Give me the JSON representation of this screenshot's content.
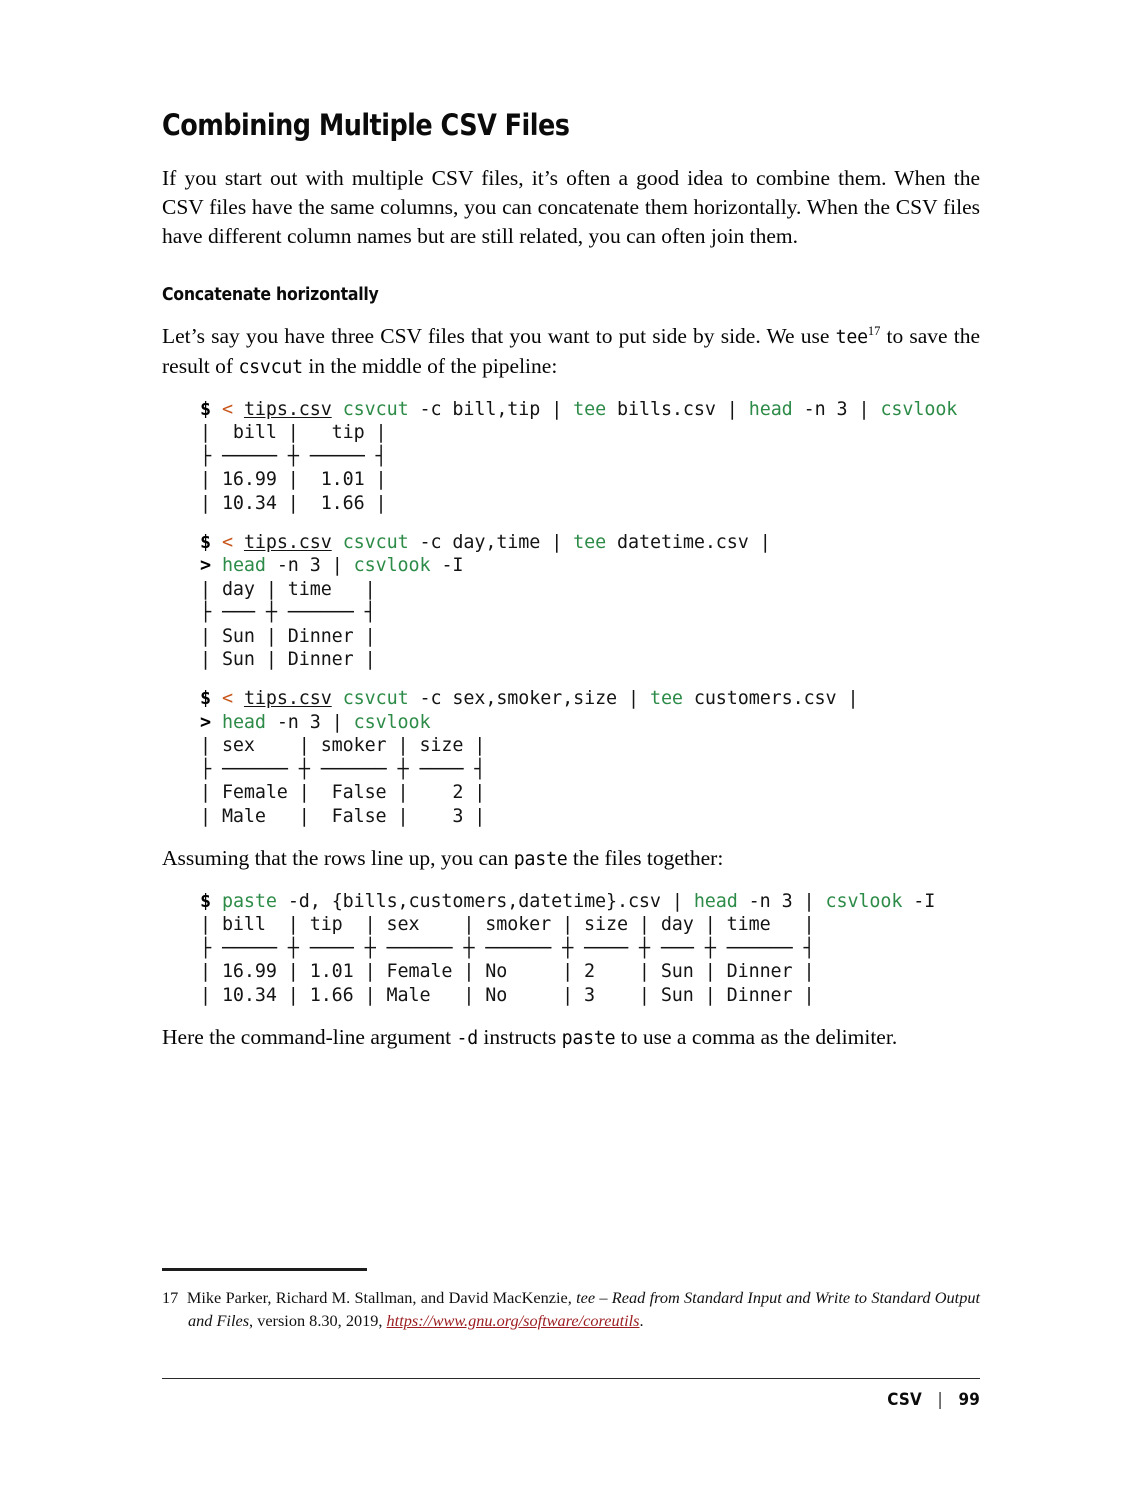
{
  "page": {
    "chapter_title": "Combining Multiple CSV Files",
    "footer_label": "CSV",
    "footer_separator": "|",
    "footer_page_number": "99"
  },
  "intro": {
    "paragraph": "If you start out with multiple CSV files, it’s often a good idea to combine them. When the CSV files have the same columns, you can concatenate them horizontally. When the CSV files have different column names but are still related, you can often join them."
  },
  "section": {
    "title": "Concatenate horizontally",
    "lead_part1": "Let’s say you have three CSV files that you want to put side by side. We use ",
    "lead_code1": "tee",
    "lead_footnote_marker": "17",
    "lead_part2": " to save the result of ",
    "lead_code2": "csvcut",
    "lead_part3": " in the middle of the pipeline:"
  },
  "assume": {
    "part1": "Assuming that the rows line up, you can ",
    "code": "paste",
    "part2": " the files together:"
  },
  "closing": {
    "part1": "Here the command-line argument ",
    "code1": "-d",
    "part2": " instructs ",
    "code2": "paste",
    "part3": " to use a comma as the delimiter."
  },
  "colors": {
    "command_green": "#2d8b48",
    "redirect_orange": "#c8551a",
    "url_red": "#9b1b1f",
    "text_black": "#111111"
  },
  "code_blocks": [
    {
      "id": "bills",
      "lines": [
        {
          "tokens": [
            {
              "t": "$",
              "c": "prompt"
            },
            {
              "t": " ",
              "c": "plain"
            },
            {
              "t": "<",
              "c": "redir"
            },
            {
              "t": " ",
              "c": "plain"
            },
            {
              "t": "tips.csv",
              "c": "file"
            },
            {
              "t": " ",
              "c": "plain"
            },
            {
              "t": "csvcut",
              "c": "cmd"
            },
            {
              "t": " -c bill,tip ",
              "c": "plain"
            },
            {
              "t": "|",
              "c": "pipe"
            },
            {
              "t": " ",
              "c": "plain"
            },
            {
              "t": "tee",
              "c": "cmd"
            },
            {
              "t": " bills.csv ",
              "c": "plain"
            },
            {
              "t": "|",
              "c": "pipe"
            },
            {
              "t": " ",
              "c": "plain"
            },
            {
              "t": "head",
              "c": "cmd"
            },
            {
              "t": " -n 3 ",
              "c": "plain"
            },
            {
              "t": "|",
              "c": "pipe"
            },
            {
              "t": " ",
              "c": "plain"
            },
            {
              "t": "csvlook",
              "c": "cmd"
            }
          ]
        },
        {
          "tokens": [
            {
              "t": "|  bill |   tip |",
              "c": "plain"
            }
          ]
        },
        {
          "tokens": [
            {
              "t": "| ----- + ----- |",
              "c": "plain"
            }
          ]
        },
        {
          "tokens": [
            {
              "t": "| 16.99 |  1.01 |",
              "c": "plain"
            }
          ]
        },
        {
          "tokens": [
            {
              "t": "| 10.34 |  1.66 |",
              "c": "plain"
            }
          ]
        }
      ]
    },
    {
      "id": "datetime",
      "lines": [
        {
          "tokens": [
            {
              "t": "$",
              "c": "prompt"
            },
            {
              "t": " ",
              "c": "plain"
            },
            {
              "t": "<",
              "c": "redir"
            },
            {
              "t": " ",
              "c": "plain"
            },
            {
              "t": "tips.csv",
              "c": "file"
            },
            {
              "t": " ",
              "c": "plain"
            },
            {
              "t": "csvcut",
              "c": "cmd"
            },
            {
              "t": " -c day,time ",
              "c": "plain"
            },
            {
              "t": "|",
              "c": "pipe"
            },
            {
              "t": " ",
              "c": "plain"
            },
            {
              "t": "tee",
              "c": "cmd"
            },
            {
              "t": " datetime.csv ",
              "c": "plain"
            },
            {
              "t": "|",
              "c": "pipe"
            }
          ]
        },
        {
          "tokens": [
            {
              "t": ">",
              "c": "prompt"
            },
            {
              "t": " ",
              "c": "plain"
            },
            {
              "t": "head",
              "c": "cmd"
            },
            {
              "t": " -n 3 ",
              "c": "plain"
            },
            {
              "t": "|",
              "c": "pipe"
            },
            {
              "t": " ",
              "c": "plain"
            },
            {
              "t": "csvlook",
              "c": "cmd"
            },
            {
              "t": " -I",
              "c": "plain"
            }
          ]
        },
        {
          "tokens": [
            {
              "t": "| day | time   |",
              "c": "plain"
            }
          ]
        },
        {
          "tokens": [
            {
              "t": "| --- + ------ |",
              "c": "plain"
            }
          ]
        },
        {
          "tokens": [
            {
              "t": "| Sun | Dinner |",
              "c": "plain"
            }
          ]
        },
        {
          "tokens": [
            {
              "t": "| Sun | Dinner |",
              "c": "plain"
            }
          ]
        }
      ]
    },
    {
      "id": "customers",
      "lines": [
        {
          "tokens": [
            {
              "t": "$",
              "c": "prompt"
            },
            {
              "t": " ",
              "c": "plain"
            },
            {
              "t": "<",
              "c": "redir"
            },
            {
              "t": " ",
              "c": "plain"
            },
            {
              "t": "tips.csv",
              "c": "file"
            },
            {
              "t": " ",
              "c": "plain"
            },
            {
              "t": "csvcut",
              "c": "cmd"
            },
            {
              "t": " -c sex,smoker,size ",
              "c": "plain"
            },
            {
              "t": "|",
              "c": "pipe"
            },
            {
              "t": " ",
              "c": "plain"
            },
            {
              "t": "tee",
              "c": "cmd"
            },
            {
              "t": " customers.csv ",
              "c": "plain"
            },
            {
              "t": "|",
              "c": "pipe"
            }
          ]
        },
        {
          "tokens": [
            {
              "t": ">",
              "c": "prompt"
            },
            {
              "t": " ",
              "c": "plain"
            },
            {
              "t": "head",
              "c": "cmd"
            },
            {
              "t": " -n 3 ",
              "c": "plain"
            },
            {
              "t": "|",
              "c": "pipe"
            },
            {
              "t": " ",
              "c": "plain"
            },
            {
              "t": "csvlook",
              "c": "cmd"
            }
          ]
        },
        {
          "tokens": [
            {
              "t": "| sex    | smoker | size |",
              "c": "plain"
            }
          ]
        },
        {
          "tokens": [
            {
              "t": "| ------ + ------ + ---- |",
              "c": "plain"
            }
          ]
        },
        {
          "tokens": [
            {
              "t": "| Female |  False |    2 |",
              "c": "plain"
            }
          ]
        },
        {
          "tokens": [
            {
              "t": "| Male   |  False |    3 |",
              "c": "plain"
            }
          ]
        }
      ]
    },
    {
      "id": "paste",
      "lines": [
        {
          "tokens": [
            {
              "t": "$",
              "c": "prompt"
            },
            {
              "t": " ",
              "c": "plain"
            },
            {
              "t": "paste",
              "c": "cmd"
            },
            {
              "t": " -d, {bills,customers,datetime}.csv ",
              "c": "plain"
            },
            {
              "t": "|",
              "c": "pipe"
            },
            {
              "t": " ",
              "c": "plain"
            },
            {
              "t": "head",
              "c": "cmd"
            },
            {
              "t": " -n 3 ",
              "c": "plain"
            },
            {
              "t": "|",
              "c": "pipe"
            },
            {
              "t": " ",
              "c": "plain"
            },
            {
              "t": "csvlook",
              "c": "cmd"
            },
            {
              "t": " -I",
              "c": "plain"
            }
          ]
        },
        {
          "tokens": [
            {
              "t": "| bill  | tip  | sex    | smoker | size | day | time   |",
              "c": "plain"
            }
          ]
        },
        {
          "tokens": [
            {
              "t": "| ----- + ---- + ------ + ------ + ---- + --- + ------ |",
              "c": "plain"
            }
          ]
        },
        {
          "tokens": [
            {
              "t": "| 16.99 | 1.01 | Female | No     | 2    | Sun | Dinner |",
              "c": "plain"
            }
          ]
        },
        {
          "tokens": [
            {
              "t": "| 10.34 | 1.66 | Male   | No     | 3    | Sun | Dinner |",
              "c": "plain"
            }
          ]
        }
      ]
    }
  ],
  "footnote": {
    "number": "17",
    "text_before_italic": "Mike Parker, Richard M. Stallman, and David MacKenzie, ",
    "italic_title": "tee – Read from Standard Input and Write to Standard Output and Files",
    "text_after_italic": ", version 8.30, 2019, ",
    "url": "https://www.gnu.org/software/coreutils",
    "trailing": "."
  }
}
